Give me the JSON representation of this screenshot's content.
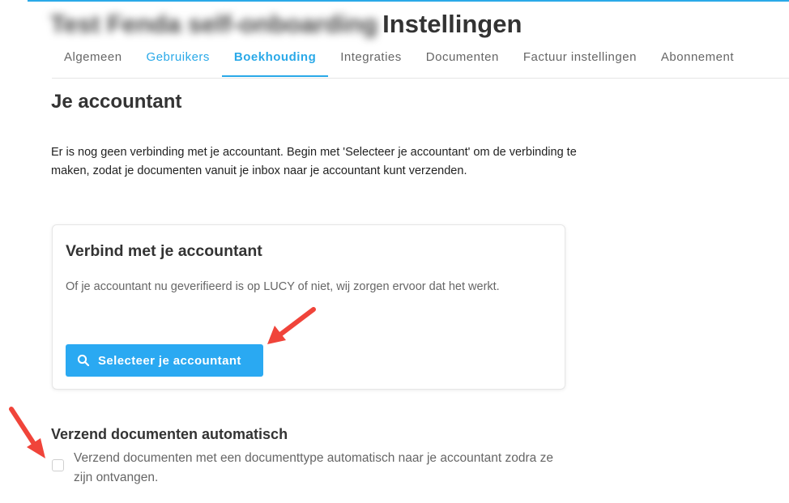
{
  "header": {
    "company_name": "Test Fenda self-onboarding",
    "title": "Instellingen"
  },
  "tabs": [
    {
      "label": "Algemeen"
    },
    {
      "label": "Gebruikers"
    },
    {
      "label": "Boekhouding"
    },
    {
      "label": "Integraties"
    },
    {
      "label": "Documenten"
    },
    {
      "label": "Factuur instellingen"
    },
    {
      "label": "Abonnement"
    }
  ],
  "active_tab": "Boekhouding",
  "accountant": {
    "heading": "Je accountant",
    "intro": "Er is nog geen verbinding met je accountant. Begin met 'Selecteer je accountant' om de verbinding te maken, zodat je documenten vanuit je inbox naar je accountant kunt verzenden."
  },
  "connect_card": {
    "title": "Verbind met je accountant",
    "description": "Of je accountant nu geverifieerd is op LUCY of niet, wij zorgen ervoor dat het werkt.",
    "button_label": "Selecteer je accountant",
    "button_icon": "search-icon"
  },
  "auto_send": {
    "title": "Verzend documenten automatisch",
    "checkbox_label": "Verzend documenten met een documenttype automatisch naar je accountant zodra ze zijn ontvangen.",
    "checked": false
  },
  "colors": {
    "accent": "#2aa9e8",
    "button": "#2aa9f2",
    "annotation_arrow": "#f0443a"
  }
}
